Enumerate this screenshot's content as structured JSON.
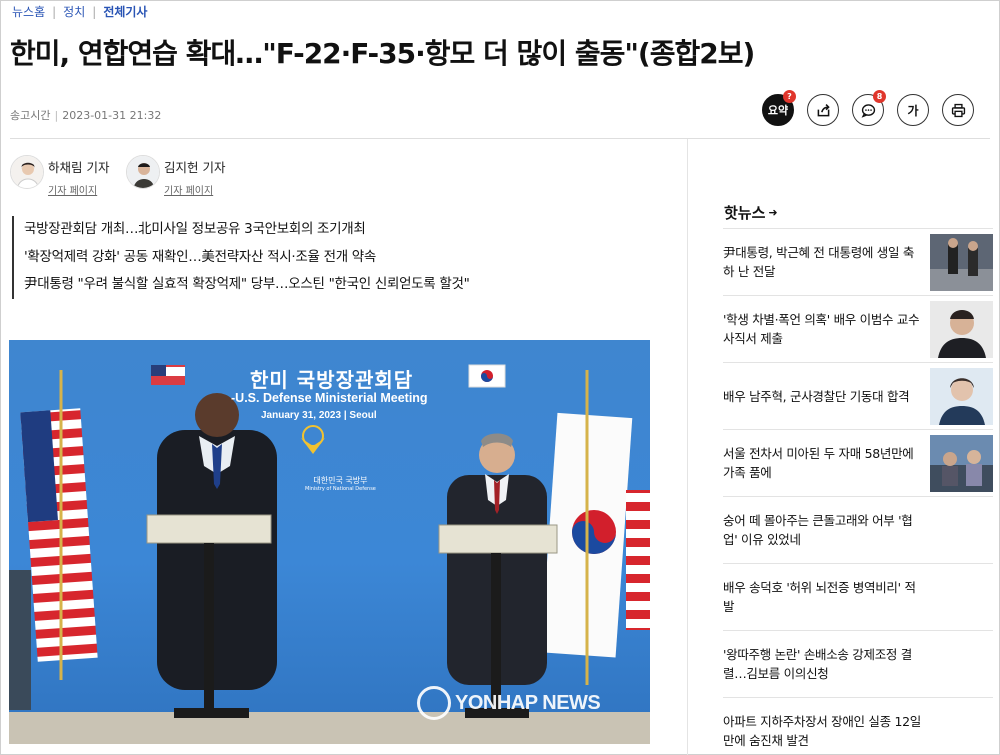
{
  "breadcrumb": {
    "home": "뉴스홈",
    "section": "정치",
    "current": "전체기사"
  },
  "article": {
    "headline": "한미, 연합연습 확대…\"F-22·F-35·항모 더 많이 출동\"(종합2보)",
    "time_label": "송고시간",
    "timestamp": "2023-01-31 21:32"
  },
  "toolbar": {
    "summary_label": "요약",
    "summary_badge": "?",
    "comment_badge": "8",
    "font_label": "가"
  },
  "reporters": [
    {
      "name": "하채림 기자",
      "link": "기자 페이지"
    },
    {
      "name": "김지헌 기자",
      "link": "기자 페이지"
    }
  ],
  "subheadlines": [
    "국방장관회담 개최…北미사일 정보공유 3국안보회의 조기개최",
    "'확장억제력 강화' 공동 재확인…美전략자산 적시·조율 전개 약속",
    "尹대통령 \"우려 불식할 실효적 확장억제\" 당부…오스틴 \"한국인 신뢰얻도록 할것\""
  ],
  "photo": {
    "backdrop_title": "한미 국방장관회담",
    "backdrop_subtitle": "-U.S. Defense Ministerial Meeting",
    "backdrop_date": "January 31, 2023 | Seoul",
    "ministry_kr": "대한민국 국방부",
    "ministry_en": "Ministry of National Defense",
    "watermark": "YONHAP NEWS"
  },
  "hot_news": {
    "title": "핫뉴스",
    "items": [
      {
        "text": "尹대통령, 박근혜 전 대통령에 생일 축하 난 전달",
        "has_thumb": true
      },
      {
        "text": "'학생 차별·폭언 의혹' 배우 이범수 교수 사직서 제출",
        "has_thumb": true
      },
      {
        "text": "배우 남주혁, 군사경찰단 기동대 합격",
        "has_thumb": true
      },
      {
        "text": "서울 전차서 미아된 두 자매 58년만에 가족 품에",
        "has_thumb": true
      },
      {
        "text": "숭어 떼 몰아주는 큰돌고래와 어부 '협업' 이유 있었네",
        "has_thumb": false
      },
      {
        "text": "배우 송덕호 '허위 뇌전증 병역비리' 적발",
        "has_thumb": false
      },
      {
        "text": "'왕따주행 논란' 손배소송 강제조정 결렬…김보름 이의신청",
        "has_thumb": false
      },
      {
        "text": "아파트 지하주차장서 장애인 실종 12일만에 숨진채 발견",
        "has_thumb": false
      }
    ]
  }
}
